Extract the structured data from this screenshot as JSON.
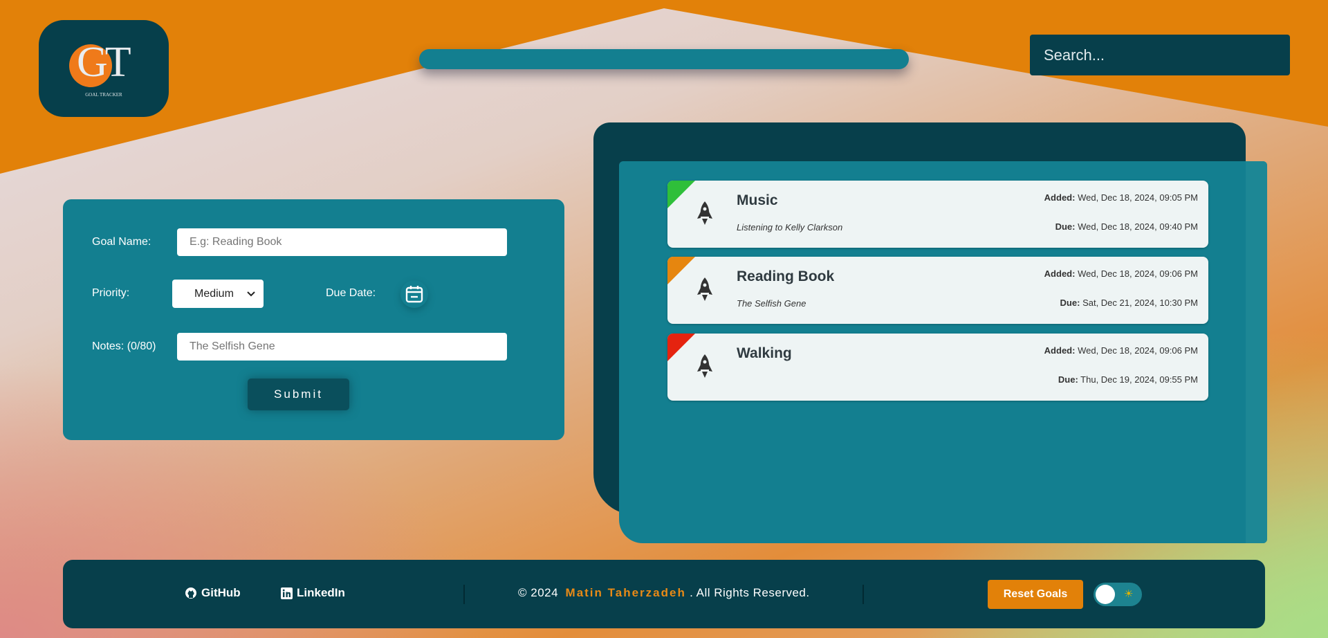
{
  "header": {
    "logo_text": "GT",
    "logo_subtitle": "GOAL TRACKER",
    "search_placeholder": "Search..."
  },
  "form": {
    "goal_name_label": "Goal Name:",
    "goal_name_placeholder": "E.g: Reading Book",
    "priority_label": "Priority:",
    "priority_selected": "Medium",
    "due_date_label": "Due Date:",
    "notes_label": "Notes: (0/80)",
    "notes_placeholder": "The Selfish Gene",
    "submit_label": "Submit"
  },
  "goals": [
    {
      "title": "Music",
      "note": "Listening to Kelly Clarkson",
      "added_label": "Added:",
      "added": "Wed, Dec 18, 2024, 09:05 PM",
      "due_label": "Due:",
      "due": "Wed, Dec 18, 2024, 09:40 PM",
      "priority_color": "#2fbf3a"
    },
    {
      "title": "Reading Book",
      "note": "The Selfish Gene",
      "added_label": "Added:",
      "added": "Wed, Dec 18, 2024, 09:06 PM",
      "due_label": "Due:",
      "due": "Sat, Dec 21, 2024, 10:30 PM",
      "priority_color": "#e6860f"
    },
    {
      "title": "Walking",
      "note": "",
      "added_label": "Added:",
      "added": "Wed, Dec 18, 2024, 09:06 PM",
      "due_label": "Due:",
      "due": "Thu, Dec 19, 2024, 09:55 PM",
      "priority_color": "#e5230f"
    }
  ],
  "footer": {
    "github_label": "GitHub",
    "linkedin_label": "LinkedIn",
    "copyright_prefix": "© 2024",
    "author": "Matin Taherzadeh",
    "copyright_suffix": ". All Rights Reserved.",
    "reset_label": "Reset Goals",
    "theme_icon": "sun-icon"
  },
  "colors": {
    "primary": "#137f90",
    "dark": "#073f4b",
    "accent": "#e28109"
  }
}
